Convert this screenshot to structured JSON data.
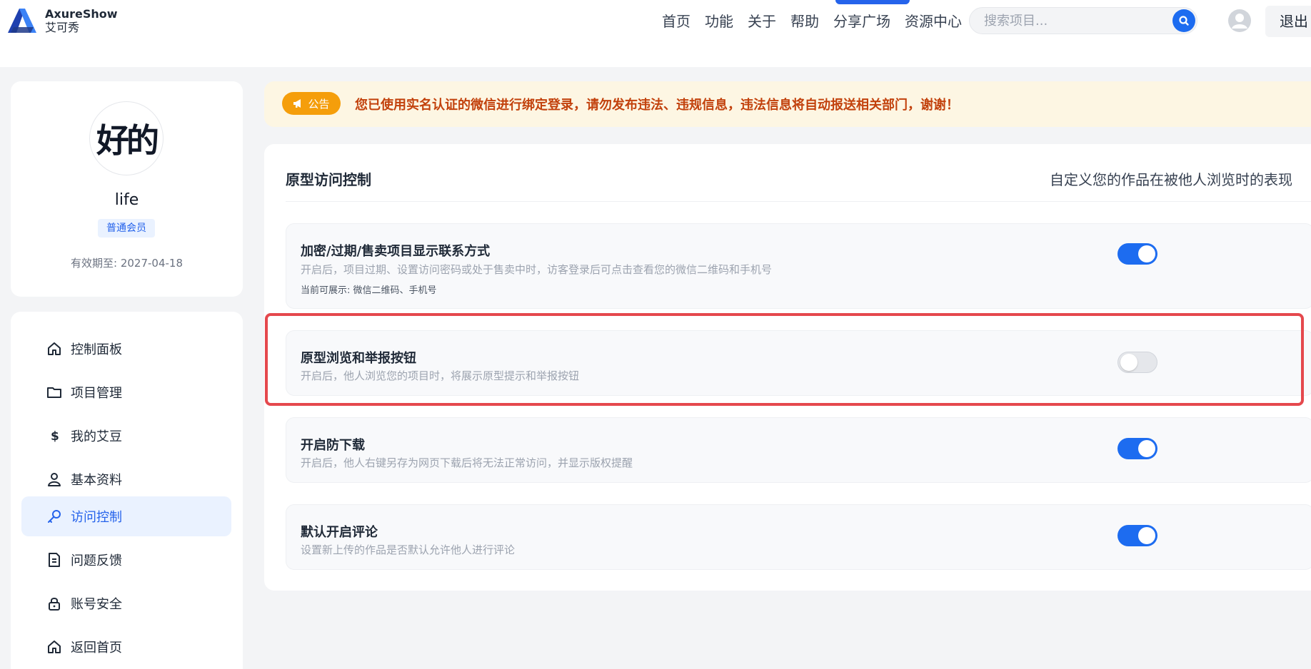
{
  "header": {
    "logo_en": "AxureShow",
    "logo_cn": "艾可秀",
    "nav": [
      "首页",
      "功能",
      "关于",
      "帮助",
      "分享广场",
      "资源中心"
    ],
    "search_placeholder": "搜索项目...",
    "logout_label": "退出"
  },
  "profile": {
    "name": "life",
    "badge": "普通会员",
    "expiry": "有效期至: 2027-04-18",
    "avatar_text": "好的"
  },
  "menu": [
    {
      "label": "控制面板",
      "icon": "home-icon"
    },
    {
      "label": "项目管理",
      "icon": "folder-icon"
    },
    {
      "label": "我的艾豆",
      "icon": "dollar-icon"
    },
    {
      "label": "基本资料",
      "icon": "user-icon"
    },
    {
      "label": "访问控制",
      "icon": "key-icon",
      "active": true
    },
    {
      "label": "问题反馈",
      "icon": "document-icon"
    },
    {
      "label": "账号安全",
      "icon": "lock-icon"
    },
    {
      "label": "返回首页",
      "icon": "home-icon"
    }
  ],
  "notice": {
    "tag": "公告",
    "text": "您已使用实名认证的微信进行绑定登录，请勿发布违法、违规信息，违法信息将自动报送相关部门，谢谢！"
  },
  "main": {
    "title": "原型访问控制",
    "subtitle": "自定义您的作品在被他人浏览时的表现",
    "settings": [
      {
        "title": "加密/过期/售卖项目显示联系方式",
        "desc": "开启后，项目过期、设置访问密码或处于售卖中时，访客登录后可点击查看您的微信二维码和手机号",
        "note": "当前可展示: 微信二维码、手机号",
        "enabled": true
      },
      {
        "title": "原型浏览和举报按钮",
        "desc": "开启后，他人浏览您的项目时，将展示原型提示和举报按钮",
        "enabled": false
      },
      {
        "title": "开启防下载",
        "desc": "开启后，他人右键另存为网页下载后将无法正常访问，并显示版权提醒",
        "enabled": true
      },
      {
        "title": "默认开启评论",
        "desc": "设置新上传的作品是否默认允许他人进行评论",
        "enabled": true
      }
    ]
  },
  "colors": {
    "accent": "#1d6cf0",
    "notice_tag": "#f59e0b",
    "notice_text": "#c2410c",
    "highlight": "#e5484d"
  }
}
